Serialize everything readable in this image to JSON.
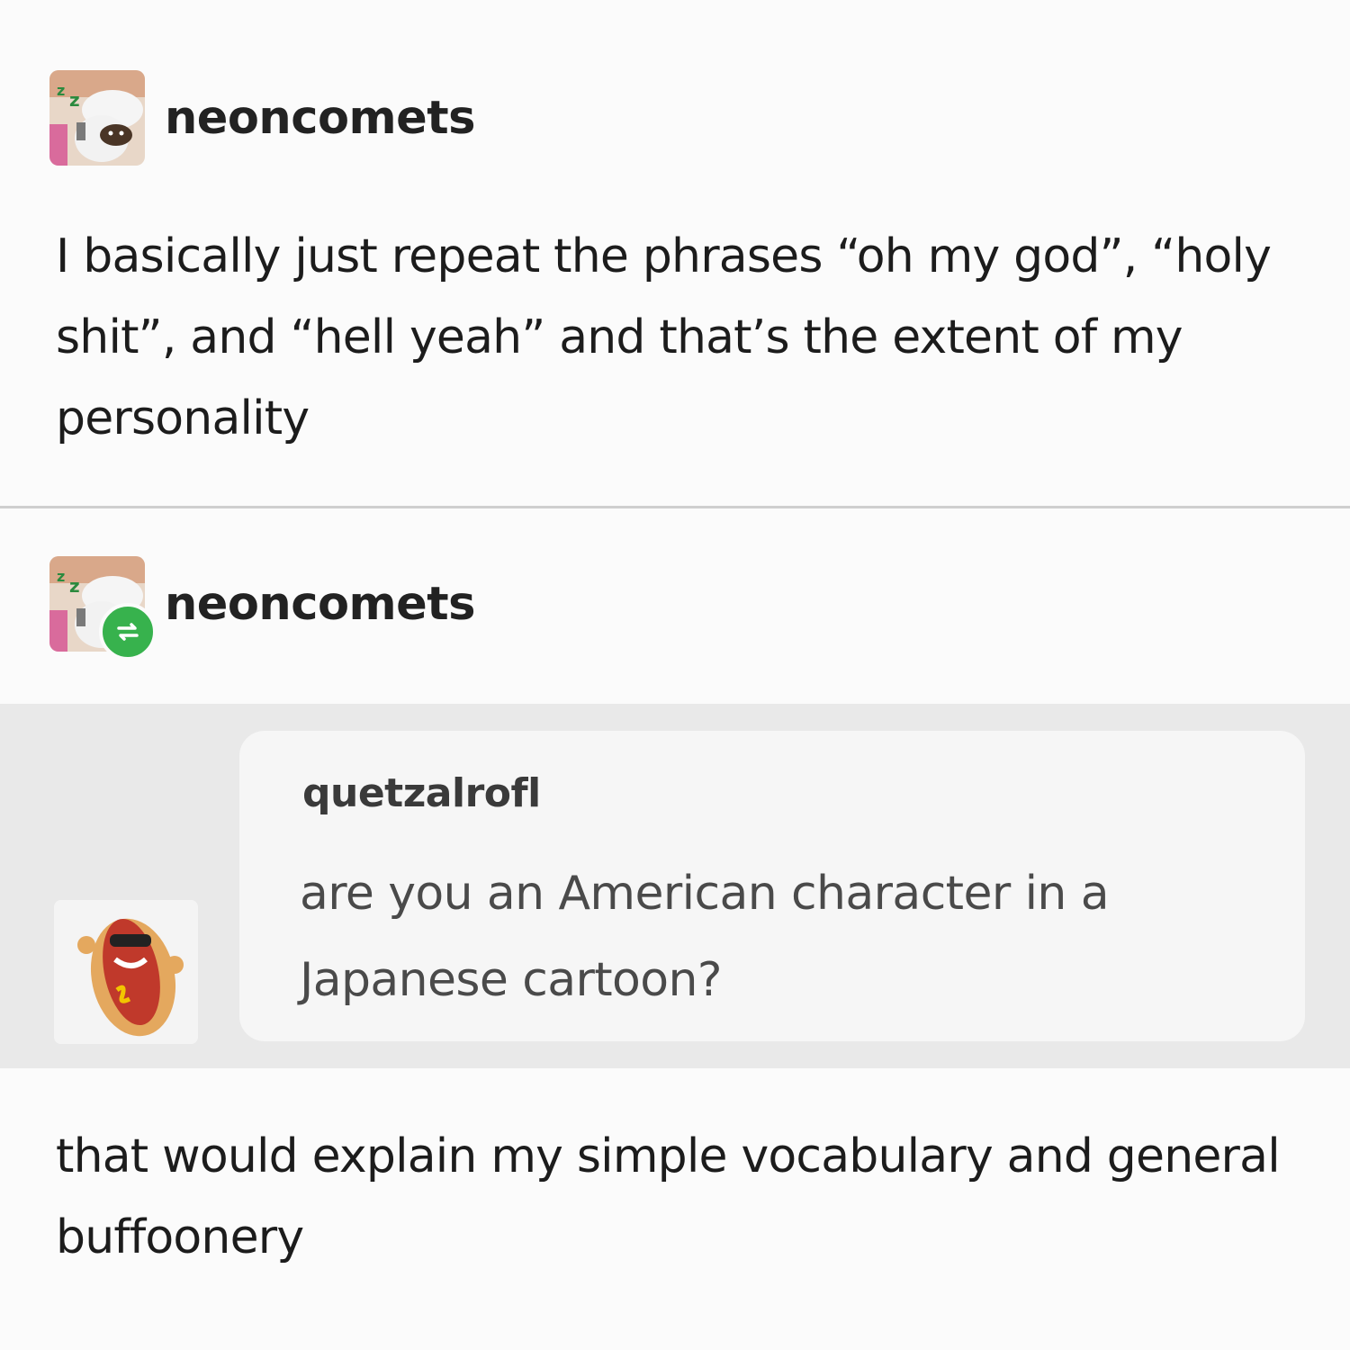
{
  "post": {
    "author": "neoncomets",
    "text": "I basically just repeat the phrases “oh my god”, “holy shit”, and “hell yeah” and that’s the extent of my personality"
  },
  "reply": {
    "author": "neoncomets",
    "icon": "reblog-icon",
    "ask": {
      "asker": "quetzalrofl",
      "question": "are you an American character in a Japanese cartoon?"
    },
    "answer": "that would explain my simple vocabulary and general buffoonery"
  },
  "colors": {
    "reblog_badge": "#37b24d",
    "ask_band": "#e9e9e9",
    "ask_bubble": "#f6f6f6"
  }
}
